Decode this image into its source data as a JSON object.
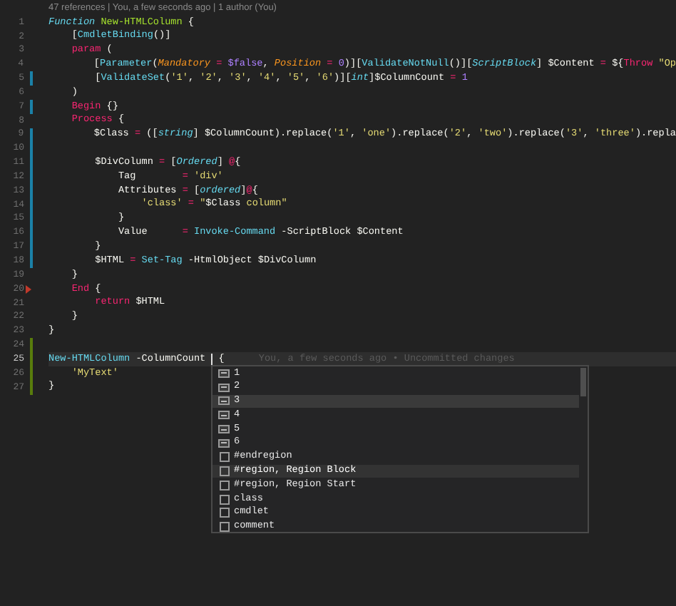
{
  "codelens": "47 references | You, a few seconds ago | 1 author (You)",
  "lines": [
    {
      "number": "1",
      "current": false,
      "kind": "unchanged",
      "tokens": [
        {
          "kind": "storage",
          "text": "Function "
        },
        {
          "kind": "fn",
          "text": "New-HTMLColumn"
        },
        {
          "kind": "plain",
          "text": " {"
        }
      ]
    },
    {
      "number": "2",
      "current": false,
      "kind": "unchanged",
      "tokens": [
        {
          "kind": "plain",
          "text": "    ["
        },
        {
          "kind": "type",
          "text": "CmdletBinding"
        },
        {
          "kind": "plain",
          "text": "()]"
        }
      ]
    },
    {
      "number": "3",
      "current": false,
      "kind": "unchanged",
      "tokens": [
        {
          "kind": "keyword",
          "text": "    param"
        },
        {
          "kind": "plain",
          "text": " ("
        }
      ]
    },
    {
      "number": "4",
      "current": false,
      "kind": "unchanged",
      "tokens": [
        {
          "kind": "plain",
          "text": "        ["
        },
        {
          "kind": "type",
          "text": "Parameter"
        },
        {
          "kind": "plain",
          "text": "("
        },
        {
          "kind": "param",
          "text": "Mandatory "
        },
        {
          "kind": "op",
          "text": "= "
        },
        {
          "kind": "const",
          "text": "$false"
        },
        {
          "kind": "plain",
          "text": ", "
        },
        {
          "kind": "param",
          "text": "Position "
        },
        {
          "kind": "op",
          "text": "= "
        },
        {
          "kind": "const",
          "text": "0"
        },
        {
          "kind": "plain",
          "text": ")]["
        },
        {
          "kind": "type",
          "text": "ValidateNotNull"
        },
        {
          "kind": "plain",
          "text": "()]["
        },
        {
          "kind": "typei",
          "text": "ScriptBlock"
        },
        {
          "kind": "plain",
          "text": "] $Content "
        },
        {
          "kind": "op",
          "text": "="
        },
        {
          "kind": "plain",
          "text": " ${"
        },
        {
          "kind": "keyword",
          "text": "Throw "
        },
        {
          "kind": "string",
          "text": "\"Op"
        }
      ]
    },
    {
      "number": "5",
      "current": false,
      "kind": "modified",
      "tokens": [
        {
          "kind": "plain",
          "text": "        ["
        },
        {
          "kind": "type",
          "text": "ValidateSet"
        },
        {
          "kind": "plain",
          "text": "("
        },
        {
          "kind": "string",
          "text": "'1'"
        },
        {
          "kind": "plain",
          "text": ", "
        },
        {
          "kind": "string",
          "text": "'2'"
        },
        {
          "kind": "plain",
          "text": ", "
        },
        {
          "kind": "string",
          "text": "'3'"
        },
        {
          "kind": "plain",
          "text": ", "
        },
        {
          "kind": "string",
          "text": "'4'"
        },
        {
          "kind": "plain",
          "text": ", "
        },
        {
          "kind": "string",
          "text": "'5'"
        },
        {
          "kind": "plain",
          "text": ", "
        },
        {
          "kind": "string",
          "text": "'6'"
        },
        {
          "kind": "plain",
          "text": ")]["
        },
        {
          "kind": "typei",
          "text": "int"
        },
        {
          "kind": "plain",
          "text": "]$ColumnCount "
        },
        {
          "kind": "op",
          "text": "= "
        },
        {
          "kind": "const",
          "text": "1"
        }
      ]
    },
    {
      "number": "6",
      "current": false,
      "kind": "unchanged",
      "tokens": [
        {
          "kind": "plain",
          "text": "    )"
        }
      ]
    },
    {
      "number": "7",
      "current": false,
      "kind": "modified",
      "tokens": [
        {
          "kind": "keyword",
          "text": "    Begin"
        },
        {
          "kind": "plain",
          "text": " {}"
        }
      ]
    },
    {
      "number": "8",
      "current": false,
      "kind": "unchanged",
      "tokens": [
        {
          "kind": "keyword",
          "text": "    Process"
        },
        {
          "kind": "plain",
          "text": " {"
        }
      ]
    },
    {
      "number": "9",
      "current": false,
      "kind": "modified",
      "tokens": [
        {
          "kind": "plain",
          "text": "        $Class "
        },
        {
          "kind": "op",
          "text": "="
        },
        {
          "kind": "plain",
          "text": " (["
        },
        {
          "kind": "typei",
          "text": "string"
        },
        {
          "kind": "plain",
          "text": "] $ColumnCount).replace("
        },
        {
          "kind": "string",
          "text": "'1'"
        },
        {
          "kind": "plain",
          "text": ", "
        },
        {
          "kind": "string",
          "text": "'one'"
        },
        {
          "kind": "plain",
          "text": ").replace("
        },
        {
          "kind": "string",
          "text": "'2'"
        },
        {
          "kind": "plain",
          "text": ", "
        },
        {
          "kind": "string",
          "text": "'two'"
        },
        {
          "kind": "plain",
          "text": ").replace("
        },
        {
          "kind": "string",
          "text": "'3'"
        },
        {
          "kind": "plain",
          "text": ", "
        },
        {
          "kind": "string",
          "text": "'three'"
        },
        {
          "kind": "plain",
          "text": ").repla"
        }
      ]
    },
    {
      "number": "10",
      "current": false,
      "kind": "modified"
    },
    {
      "number": "11",
      "current": false,
      "kind": "modified",
      "tokens": [
        {
          "kind": "plain",
          "text": "        $DivColumn "
        },
        {
          "kind": "op",
          "text": "="
        },
        {
          "kind": "plain",
          "text": " ["
        },
        {
          "kind": "typei",
          "text": "Ordered"
        },
        {
          "kind": "plain",
          "text": "] "
        },
        {
          "kind": "op",
          "text": "@"
        },
        {
          "kind": "plain",
          "text": "{"
        }
      ]
    },
    {
      "number": "12",
      "current": false,
      "kind": "modified",
      "tokens": [
        {
          "kind": "plain",
          "text": "            Tag        "
        },
        {
          "kind": "op",
          "text": "= "
        },
        {
          "kind": "string",
          "text": "'div'"
        }
      ]
    },
    {
      "number": "13",
      "current": false,
      "kind": "modified",
      "tokens": [
        {
          "kind": "plain",
          "text": "            Attributes "
        },
        {
          "kind": "op",
          "text": "="
        },
        {
          "kind": "plain",
          "text": " ["
        },
        {
          "kind": "typei",
          "text": "ordered"
        },
        {
          "kind": "plain",
          "text": "]"
        },
        {
          "kind": "op",
          "text": "@"
        },
        {
          "kind": "plain",
          "text": "{"
        }
      ]
    },
    {
      "number": "14",
      "current": false,
      "kind": "modified",
      "tokens": [
        {
          "kind": "string",
          "text": "                'class' "
        },
        {
          "kind": "op",
          "text": "= "
        },
        {
          "kind": "string",
          "text": "\""
        },
        {
          "kind": "plain",
          "text": "$Class"
        },
        {
          "kind": "string",
          "text": " column\""
        }
      ]
    },
    {
      "number": "15",
      "current": false,
      "kind": "modified",
      "tokens": [
        {
          "kind": "plain",
          "text": "            }"
        }
      ]
    },
    {
      "number": "16",
      "current": false,
      "kind": "modified",
      "tokens": [
        {
          "kind": "plain",
          "text": "            Value      "
        },
        {
          "kind": "op",
          "text": "= "
        },
        {
          "kind": "cmd",
          "text": "Invoke-Command"
        },
        {
          "kind": "plain",
          "text": " -ScriptBlock $Content"
        }
      ]
    },
    {
      "number": "17",
      "current": false,
      "kind": "modified",
      "tokens": [
        {
          "kind": "plain",
          "text": "        }"
        }
      ]
    },
    {
      "number": "18",
      "current": false,
      "kind": "modified",
      "tokens": [
        {
          "kind": "plain",
          "text": "        $HTML "
        },
        {
          "kind": "op",
          "text": "= "
        },
        {
          "kind": "cmd",
          "text": "Set-Tag"
        },
        {
          "kind": "plain",
          "text": " -HtmlObject $DivColumn"
        }
      ]
    },
    {
      "number": "19",
      "current": false,
      "kind": "unchanged",
      "tokens": [
        {
          "kind": "plain",
          "text": "    }"
        }
      ]
    },
    {
      "number": "20",
      "current": false,
      "kind": "deleted",
      "tokens": [
        {
          "kind": "keyword",
          "text": "    End"
        },
        {
          "kind": "plain",
          "text": " {"
        }
      ]
    },
    {
      "number": "21",
      "current": false,
      "kind": "unchanged",
      "tokens": [
        {
          "kind": "keyword",
          "text": "        return"
        },
        {
          "kind": "plain",
          "text": " $HTML"
        }
      ]
    },
    {
      "number": "22",
      "current": false,
      "kind": "unchanged",
      "tokens": [
        {
          "kind": "plain",
          "text": "    }"
        }
      ]
    },
    {
      "number": "23",
      "current": false,
      "kind": "unchanged",
      "tokens": [
        {
          "kind": "plain",
          "text": "}"
        }
      ]
    },
    {
      "number": "24",
      "current": false,
      "kind": "added"
    },
    {
      "number": "25",
      "current": true,
      "kind": "added",
      "blame": "You, a few seconds ago • Uncommitted changes",
      "tokens": [
        {
          "kind": "cmd",
          "text": "New-HTMLColumn"
        },
        {
          "kind": "plain",
          "text": " -ColumnCount "
        },
        {
          "kind": "cursor"
        },
        {
          "kind": "plain",
          "text": " {"
        }
      ]
    },
    {
      "number": "26",
      "current": false,
      "kind": "added",
      "tokens": [
        {
          "kind": "string",
          "text": "    'MyText'"
        }
      ]
    },
    {
      "number": "27",
      "current": false,
      "kind": "added",
      "tokens": [
        {
          "kind": "plain",
          "text": "}"
        }
      ]
    }
  ],
  "suggestions": [
    {
      "kind": "value",
      "label": "1",
      "selected": false,
      "hovered": false
    },
    {
      "kind": "value",
      "label": "2",
      "selected": false,
      "hovered": false
    },
    {
      "kind": "value",
      "label": "3",
      "selected": true,
      "hovered": false
    },
    {
      "kind": "value",
      "label": "4",
      "selected": false,
      "hovered": false
    },
    {
      "kind": "value",
      "label": "5",
      "selected": false,
      "hovered": false
    },
    {
      "kind": "value",
      "label": "6",
      "selected": false,
      "hovered": false
    },
    {
      "kind": "snippet",
      "label": "#endregion",
      "selected": false,
      "hovered": false
    },
    {
      "kind": "snippet",
      "label": "#region, Region Block",
      "selected": false,
      "hovered": true
    },
    {
      "kind": "snippet",
      "label": "#region, Region Start",
      "selected": false,
      "hovered": false
    },
    {
      "kind": "snippet",
      "label": "class",
      "selected": false,
      "hovered": false
    },
    {
      "kind": "snippet",
      "label": "cmdlet",
      "selected": false,
      "hovered": false
    },
    {
      "kind": "snippet",
      "label": "comment",
      "selected": false,
      "hovered": false
    }
  ]
}
